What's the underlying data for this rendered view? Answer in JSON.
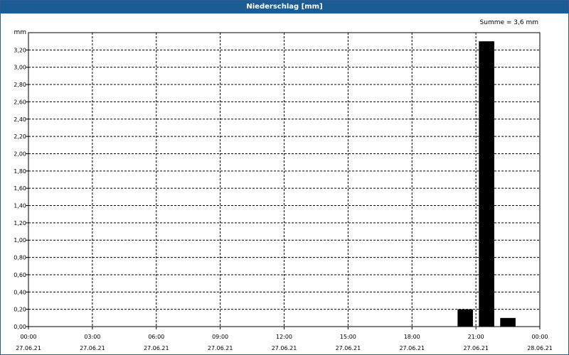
{
  "chart_data": {
    "type": "bar",
    "title": "Niederschlag [mm]",
    "annotation": "Summe = 3,6 mm",
    "ylabel": "mm",
    "ylim": [
      0,
      3.4
    ],
    "yticks": [
      "0,00",
      "0,20",
      "0,40",
      "0,60",
      "0,80",
      "1,00",
      "1,20",
      "1,40",
      "1,60",
      "1,80",
      "2,00",
      "2,20",
      "2,40",
      "2,60",
      "2,80",
      "3,00",
      "3,20"
    ],
    "xlim_hours": [
      0,
      24
    ],
    "xticks": [
      {
        "time": "00:00",
        "date": "27.06.21"
      },
      {
        "time": "03:00",
        "date": "27.06.21"
      },
      {
        "time": "06:00",
        "date": "27.06.21"
      },
      {
        "time": "09:00",
        "date": "27.06.21"
      },
      {
        "time": "12:00",
        "date": "27.06.21"
      },
      {
        "time": "15:00",
        "date": "27.06.21"
      },
      {
        "time": "18:00",
        "date": "27.06.21"
      },
      {
        "time": "21:00",
        "date": "27.06.21"
      },
      {
        "time": "00:00",
        "date": "28.06.21"
      }
    ],
    "bars": [
      {
        "x": "20:30",
        "value": 0.2
      },
      {
        "x": "21:30",
        "value": 3.3
      },
      {
        "x": "22:30",
        "value": 0.1
      }
    ],
    "grid": true,
    "bar_color": "#000000"
  }
}
